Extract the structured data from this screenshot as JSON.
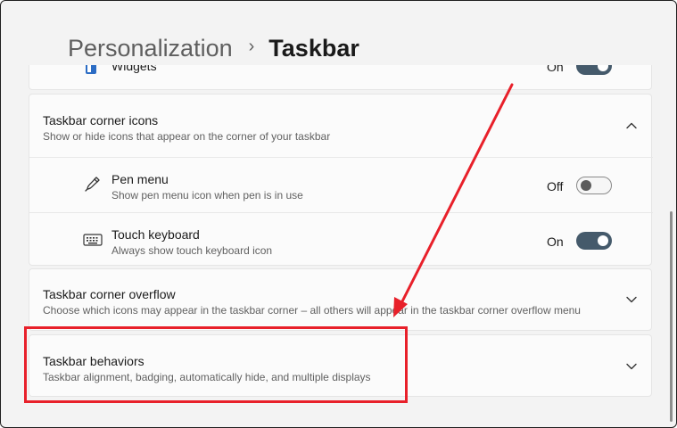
{
  "breadcrumb": {
    "parent": "Personalization",
    "separator": "›",
    "current": "Taskbar"
  },
  "widgets_row": {
    "label": "Widgets",
    "state_label": "On",
    "state": "on"
  },
  "corner_icons": {
    "title": "Taskbar corner icons",
    "subtitle": "Show or hide icons that appear on the corner of your taskbar",
    "expanded": true,
    "items": [
      {
        "title": "Pen menu",
        "subtitle": "Show pen menu icon when pen is in use",
        "state_label": "Off",
        "state": "off",
        "icon": "pen-icon"
      },
      {
        "title": "Touch keyboard",
        "subtitle": "Always show touch keyboard icon",
        "state_label": "On",
        "state": "on",
        "icon": "keyboard-icon"
      }
    ]
  },
  "corner_overflow": {
    "title": "Taskbar corner overflow",
    "subtitle": "Choose which icons may appear in the taskbar corner – all others will appear in the taskbar corner overflow menu"
  },
  "behaviors": {
    "title": "Taskbar behaviors",
    "subtitle": "Taskbar alignment, badging, automatically hide, and multiple displays"
  },
  "colors": {
    "background": "#f3f3f3",
    "card": "#fbfbfb",
    "toggle_on": "#455a6b",
    "annotation": "#e8202a"
  }
}
